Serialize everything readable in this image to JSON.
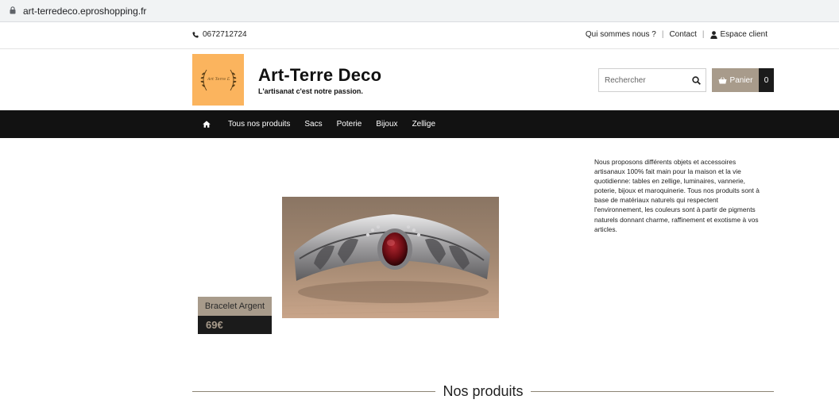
{
  "browser": {
    "url": "art-terredeco.eproshopping.fr"
  },
  "topbar": {
    "phone": "0672712724",
    "links": {
      "about": "Qui sommes nous ?",
      "contact": "Contact",
      "account": "Espace client"
    }
  },
  "header": {
    "logo_text": "Art Terre Deco",
    "brand_name": "Art-Terre Deco",
    "tagline": "L'artisanat c'est notre passion.",
    "search_placeholder": "Rechercher",
    "cart_label": "Panier",
    "cart_count": "0"
  },
  "nav": {
    "items": [
      "Tous nos produits",
      "Sacs",
      "Poterie",
      "Bijoux",
      "Zellige"
    ]
  },
  "featured": {
    "name": "Bracelet Argent",
    "price": "69€"
  },
  "description": "Nous proposons différents objets et accessoires artisanaux 100% fait main pour la maison et la vie quotidienne: tables en zellige, luminaires, vannerie, poterie, bijoux et maroquinerie. Tous nos produits sont à base de matériaux naturels qui respectent l'environnement, les couleurs sont à partir de pigments naturels donnant charme, raffinement et exotisme à vos articles.",
  "section": {
    "title": "Nos produits"
  },
  "colors": {
    "accent": "#a89b8b",
    "nav_bg": "#121212",
    "logo_bg": "#fbb45e"
  }
}
